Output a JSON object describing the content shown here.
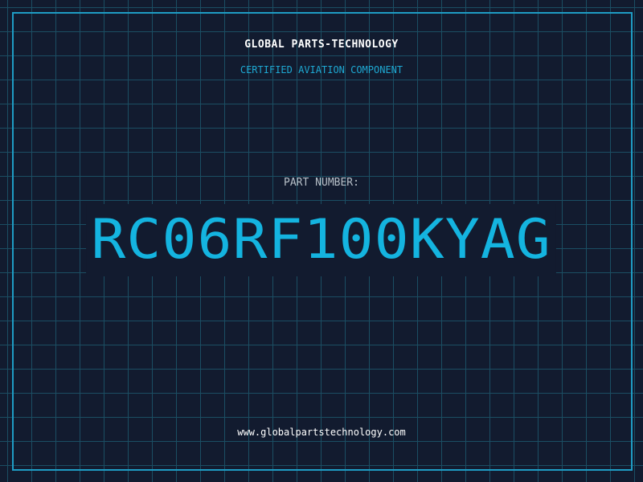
{
  "label": {
    "brand": "GLOBAL PARTS-TECHNOLOGY",
    "subtitle": "CERTIFIED AVIATION COMPONENT",
    "part_number_label": "PART NUMBER:",
    "part_number": "RC06RF100KYAG",
    "website": "www.globalpartstechnology.com"
  },
  "colors": {
    "background": "#121b2f",
    "grid": "#1b4e63",
    "frame": "#1e9cc4",
    "accent": "#14b4e0",
    "brand_text": "#ffffff",
    "label_text": "#b7c0c8"
  }
}
